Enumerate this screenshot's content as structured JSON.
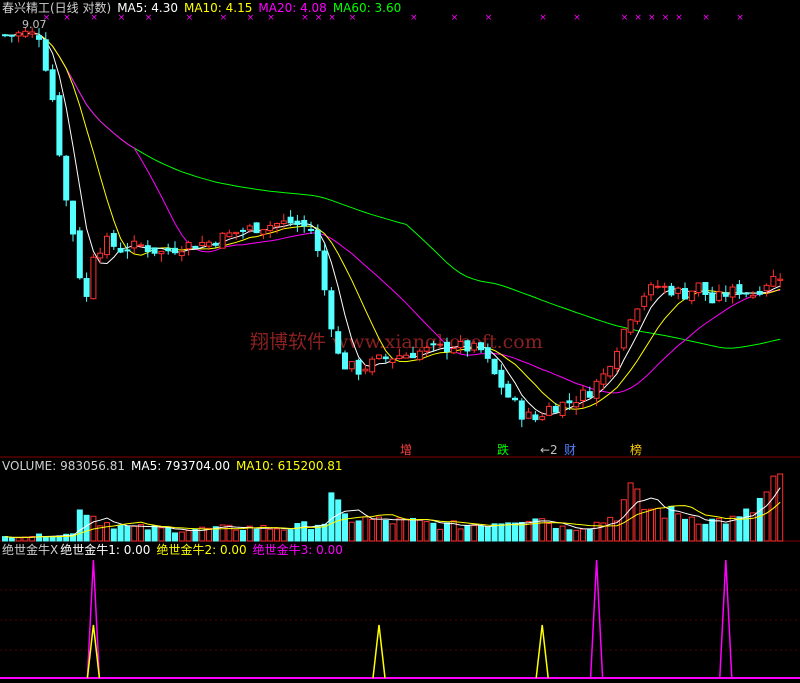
{
  "colors": {
    "bg": "#000000",
    "up": "#ff3030",
    "down": "#54ffff",
    "ma5": "#ffffff",
    "ma10": "#ffff00",
    "ma20": "#ff00ff",
    "ma60": "#00ff00",
    "grid": "#800000",
    "watermark": "#8b2020",
    "signal": "#ff00ff"
  },
  "header": {
    "title": "春兴精工(日线 对数)",
    "ma5": "MA5: 4.30",
    "ma10": "MA10: 4.15",
    "ma20": "MA20: 4.08",
    "ma60": "MA60: 3.60",
    "high_label": "9.07",
    "signal_marks": "××"
  },
  "volume_header": {
    "volume": "VOLUME: 983056.81",
    "ma5": "MA5: 793704.00",
    "ma10": "MA10: 615200.81"
  },
  "indicator_header": {
    "name": "绝世金牛X",
    "line1": "绝世金牛1: 0.00",
    "line2": "绝世金牛2: 0.00",
    "line3": "绝世金牛3: 0.00"
  },
  "watermark": {
    "text": "翔博软件 www.xiangbosoft.com"
  },
  "annotations": [
    {
      "text": "增",
      "color": "#ff4040"
    },
    {
      "text": "跌",
      "color": "#00ff00"
    },
    {
      "text": "←2",
      "color": "#c0c0c0"
    },
    {
      "text": "财",
      "color": "#5080ff"
    },
    {
      "text": "榜",
      "color": "#ffcc00"
    }
  ],
  "chart_data": {
    "type": "candlestick",
    "y_scale": "log",
    "price_range": [
      2.5,
      9.2
    ],
    "bar_count": 115,
    "price_high_label": 9.07,
    "ma_last": {
      "ma5": 4.3,
      "ma10": 4.15,
      "ma20": 4.08,
      "ma60": 3.6
    },
    "price_path": [
      [
        0,
        9.0
      ],
      [
        3,
        9.05
      ],
      [
        5,
        9.0
      ],
      [
        6,
        8.2
      ],
      [
        7,
        7.4
      ],
      [
        8,
        6.3
      ],
      [
        9,
        5.4
      ],
      [
        10,
        4.9
      ],
      [
        11,
        4.3
      ],
      [
        12,
        4.0
      ],
      [
        13,
        4.6
      ],
      [
        15,
        4.75
      ],
      [
        17,
        4.65
      ],
      [
        20,
        4.7
      ],
      [
        23,
        4.6
      ],
      [
        26,
        4.7
      ],
      [
        30,
        4.75
      ],
      [
        34,
        4.9
      ],
      [
        38,
        5.0
      ],
      [
        42,
        5.05
      ],
      [
        45,
        4.95
      ],
      [
        46,
        4.6
      ],
      [
        47,
        4.1
      ],
      [
        48,
        3.7
      ],
      [
        49,
        3.35
      ],
      [
        50,
        3.25
      ],
      [
        52,
        3.2
      ],
      [
        55,
        3.3
      ],
      [
        58,
        3.35
      ],
      [
        62,
        3.4
      ],
      [
        66,
        3.45
      ],
      [
        70,
        3.4
      ],
      [
        72,
        3.15
      ],
      [
        74,
        2.95
      ],
      [
        76,
        2.8
      ],
      [
        78,
        2.75
      ],
      [
        80,
        2.85
      ],
      [
        83,
        2.9
      ],
      [
        86,
        3.0
      ],
      [
        88,
        3.15
      ],
      [
        90,
        3.45
      ],
      [
        92,
        3.8
      ],
      [
        94,
        4.05
      ],
      [
        96,
        4.15
      ],
      [
        98,
        4.1
      ],
      [
        100,
        4.05
      ],
      [
        102,
        4.15
      ],
      [
        104,
        3.95
      ],
      [
        106,
        4.05
      ],
      [
        108,
        4.1
      ],
      [
        110,
        4.05
      ],
      [
        112,
        4.2
      ],
      [
        114,
        4.3
      ]
    ],
    "volume_path": [
      [
        0,
        60000
      ],
      [
        5,
        80000
      ],
      [
        10,
        100000
      ],
      [
        11,
        600000
      ],
      [
        12,
        450000
      ],
      [
        14,
        300000
      ],
      [
        18,
        200000
      ],
      [
        25,
        170000
      ],
      [
        30,
        180000
      ],
      [
        36,
        200000
      ],
      [
        42,
        190000
      ],
      [
        47,
        280000
      ],
      [
        48,
        600000
      ],
      [
        50,
        350000
      ],
      [
        55,
        300000
      ],
      [
        60,
        280000
      ],
      [
        65,
        230000
      ],
      [
        70,
        240000
      ],
      [
        74,
        320000
      ],
      [
        78,
        380000
      ],
      [
        82,
        200000
      ],
      [
        86,
        230000
      ],
      [
        88,
        300000
      ],
      [
        90,
        400000
      ],
      [
        91,
        580000
      ],
      [
        92,
        720000
      ],
      [
        94,
        500000
      ],
      [
        96,
        450000
      ],
      [
        100,
        380000
      ],
      [
        104,
        300000
      ],
      [
        108,
        320000
      ],
      [
        110,
        460000
      ],
      [
        112,
        700000
      ],
      [
        114,
        983056
      ]
    ],
    "vol_ma_last": {
      "ma5": 793704.0,
      "ma10": 615200.81
    },
    "indicator": {
      "series": [
        {
          "name": "绝世金牛1",
          "last": 0.0
        },
        {
          "name": "绝世金牛2",
          "last": 0.0
        },
        {
          "name": "绝世金牛3",
          "last": 0.0
        }
      ],
      "spikes": [
        {
          "bar": 13,
          "series": "绝世金牛3",
          "value": 1.0
        },
        {
          "bar": 13,
          "series": "绝世金牛2",
          "value": 0.45
        },
        {
          "bar": 55,
          "series": "绝世金牛2",
          "value": 0.45
        },
        {
          "bar": 79,
          "series": "绝世金牛2",
          "value": 0.45
        },
        {
          "bar": 87,
          "series": "绝世金牛3",
          "value": 1.0
        },
        {
          "bar": 106,
          "series": "绝世金牛3",
          "value": 1.0
        }
      ]
    }
  }
}
